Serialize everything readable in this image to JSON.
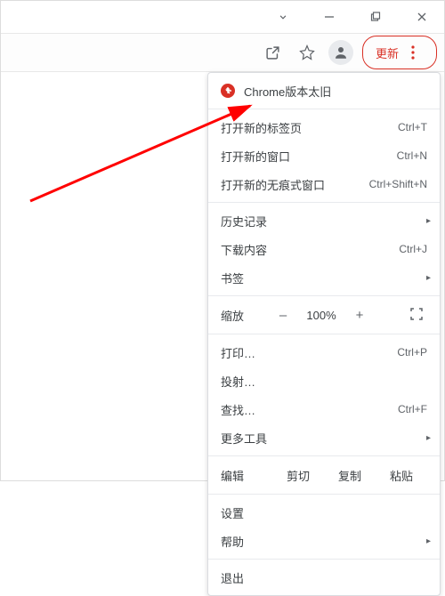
{
  "titlebar": {
    "dropdown": "⌄",
    "minimize": "–",
    "maximize": "❐",
    "close": "✕"
  },
  "toolbar": {
    "update_label": "更新"
  },
  "menu": {
    "warning": "Chrome版本太旧",
    "new_tab": {
      "label": "打开新的标签页",
      "shortcut": "Ctrl+T"
    },
    "new_window": {
      "label": "打开新的窗口",
      "shortcut": "Ctrl+N"
    },
    "new_incognito": {
      "label": "打开新的无痕式窗口",
      "shortcut": "Ctrl+Shift+N"
    },
    "history": {
      "label": "历史记录"
    },
    "downloads": {
      "label": "下载内容",
      "shortcut": "Ctrl+J"
    },
    "bookmarks": {
      "label": "书签"
    },
    "zoom": {
      "label": "缩放",
      "minus": "–",
      "value": "100%",
      "plus": "+"
    },
    "print": {
      "label": "打印…",
      "shortcut": "Ctrl+P"
    },
    "cast": {
      "label": "投射…"
    },
    "find": {
      "label": "查找…",
      "shortcut": "Ctrl+F"
    },
    "more_tools": {
      "label": "更多工具"
    },
    "edit": {
      "label": "编辑",
      "cut": "剪切",
      "copy": "复制",
      "paste": "粘贴"
    },
    "settings": {
      "label": "设置"
    },
    "help": {
      "label": "帮助"
    },
    "exit": {
      "label": "退出"
    }
  }
}
